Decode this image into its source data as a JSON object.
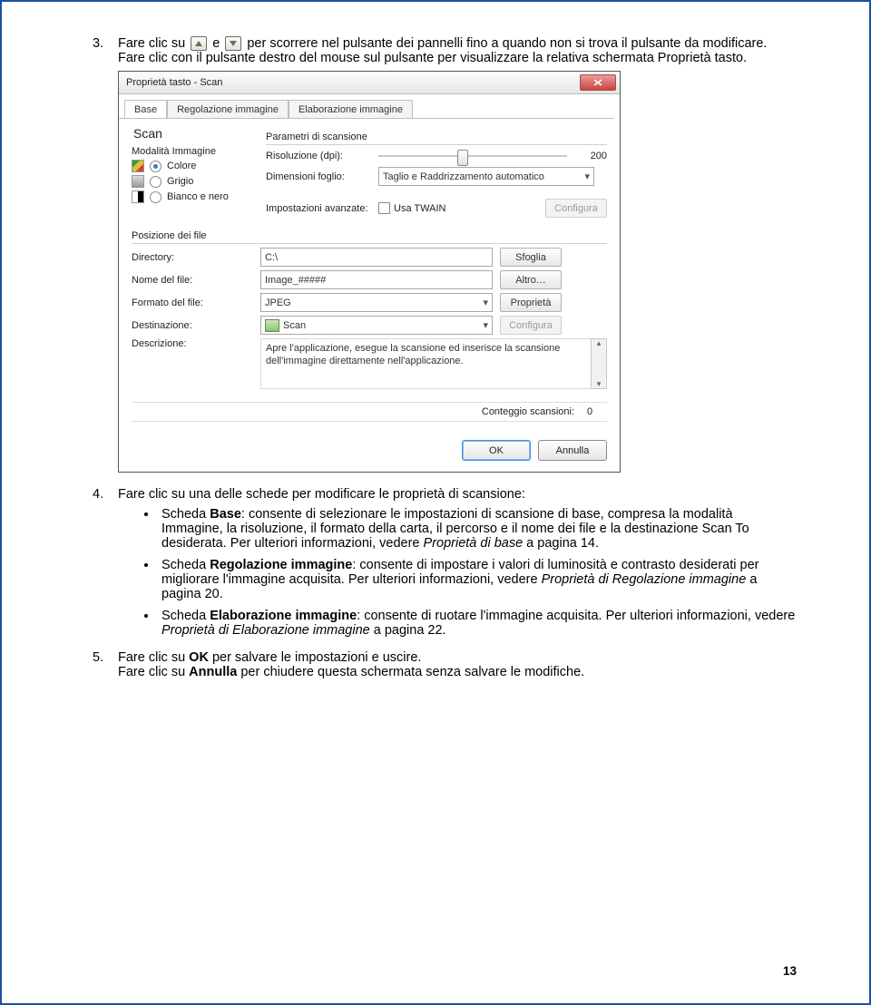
{
  "page_number": "13",
  "step3": {
    "num": "3.",
    "part1": "Fare clic su ",
    "part2": " e ",
    "part3": " per scorrere nel pulsante dei pannelli fino a quando non si trova il pulsante da modificare. Fare clic con il pulsante destro del mouse sul pulsante per visualizzare la relativa schermata Proprietà tasto."
  },
  "dialog": {
    "title": "Proprietà tasto - Scan",
    "tabs": {
      "base": "Base",
      "reg": "Regolazione immagine",
      "elab": "Elaborazione immagine"
    },
    "scan_heading": "Scan",
    "group_modalita": "Modalità Immagine",
    "radio_colore": "Colore",
    "radio_grigio": "Grigio",
    "radio_bn": "Bianco e nero",
    "group_param": "Parametri di scansione",
    "lbl_ris": "Risoluzione (dpi):",
    "ris_val": "200",
    "lbl_dim": "Dimensioni foglio:",
    "dim_val": "Taglio e Raddrizzamento automatico",
    "lbl_adv": "Impostazioni avanzate:",
    "chk_twain": "Usa TWAIN",
    "btn_config": "Configura",
    "group_pos": "Posizione dei file",
    "lbl_dir": "Directory:",
    "dir_val": "C:\\",
    "btn_sfoglia": "Sfoglia",
    "lbl_nome": "Nome del file:",
    "nome_val": "Image_#####",
    "btn_altro": "Altro…",
    "lbl_fmt": "Formato del file:",
    "fmt_val": "JPEG",
    "btn_prop": "Proprietà",
    "lbl_dest": "Destinazione:",
    "dest_val": "Scan",
    "btn_config2": "Configura",
    "lbl_descr": "Descrizione:",
    "descr_val": "Apre l'applicazione, esegue la scansione ed inserisce la scansione dell'immagine direttamente nell'applicazione.",
    "lbl_count": "Conteggio scansioni:",
    "count_val": "0",
    "btn_ok": "OK",
    "btn_annulla": "Annulla"
  },
  "step4": {
    "num": "4.",
    "text": "Fare clic su una delle schede per modificare le proprietà di scansione:",
    "b1a": "Scheda ",
    "b1b": "Base",
    "b1c": ": consente di selezionare le impostazioni di scansione di base, compresa la modalità Immagine, la risoluzione, il formato della carta, il percorso e il nome dei file e la destinazione Scan To desiderata. Per ulteriori informazioni, vedere ",
    "b1d": "Proprietà di base",
    "b1e": "  a pagina 14.",
    "b2a": "Scheda ",
    "b2b": "Regolazione immagine",
    "b2c": ": consente di impostare i valori di luminosità e contrasto desiderati per migliorare l'immagine acquisita. Per ulteriori informazioni, vedere ",
    "b2d": "Proprietà di Regolazione immagine",
    "b2e": " a pagina 20.",
    "b3a": "Scheda ",
    "b3b": "Elaborazione immagine",
    "b3c": ": consente di ruotare l'immagine acquisita. Per ulteriori informazioni, vedere ",
    "b3d": "Proprietà di Elaborazione immagine",
    "b3e": " a pagina 22."
  },
  "step5": {
    "num": "5.",
    "l1a": "Fare clic su ",
    "l1b": "OK",
    "l1c": " per salvare le impostazioni e uscire.",
    "l2a": "Fare clic su ",
    "l2b": "Annulla",
    "l2c": " per chiudere questa schermata senza salvare le modifiche."
  }
}
